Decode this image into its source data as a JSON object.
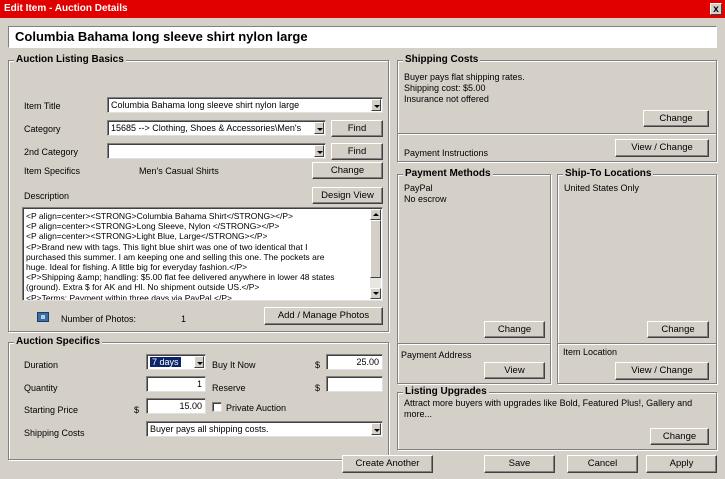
{
  "window": {
    "title": "Edit Item - Auction Details",
    "close": "x"
  },
  "header": {
    "title": "Columbia Bahama long sleeve shirt nylon large"
  },
  "basics": {
    "legend": "Auction Listing Basics",
    "item_title_label": "Item Title",
    "item_title_value": "Columbia Bahama long sleeve shirt nylon large",
    "category_label": "Category",
    "category_value": "15685 --> Clothing, Shoes & Accessories\\Men's",
    "find_label": "Find",
    "category2_label": "2nd Category",
    "category2_value": "",
    "find2_label": "Find",
    "specifics_label": "Item Specifics",
    "specifics_value": "Men's Casual Shirts",
    "change_label": "Change",
    "description_label": "Description",
    "design_view_label": "Design View",
    "description_lines": [
      "<P align=center><STRONG>Columbia Bahama Shirt</STRONG></P>",
      "<P align=center><STRONG>Long Sleeve, Nylon </STRONG></P>",
      "<P align=center><STRONG>Light Blue, Large</STRONG></P>",
      "<P>Brand new with tags. This light blue shirt was one of two identical that I",
      "purchased this summer. I am keeping one and selling this one. The pockets are",
      "huge. Ideal for fishing. A little big for everyday fashion.</P>",
      "<P>Shipping &amp; handling: $5.00 flat fee delivered anywhere in lower 48 states",
      "(ground). Extra $ for AK and HI. No shipment outside US.</P>",
      "<P>Terms: Payment within three days via PayPal.</P>"
    ],
    "photos_label": "Number of Photos:",
    "photos_count": "1",
    "manage_photos_label": "Add / Manage Photos"
  },
  "specifics": {
    "legend": "Auction Specifics",
    "duration_label": "Duration",
    "duration_value": "7 days",
    "buy_now_label": "Buy It Now",
    "dollar": "$",
    "buy_now_value": "25.00",
    "quantity_label": "Quantity",
    "quantity_value": "1",
    "reserve_label": "Reserve",
    "reserve_value": "",
    "starting_price_label": "Starting Price",
    "starting_price_value": "15.00",
    "private_label": "Private Auction",
    "shipping_label": "Shipping Costs",
    "shipping_value": "Buyer pays all shipping costs."
  },
  "shipping": {
    "legend": "Shipping Costs",
    "lines": [
      "Buyer pays flat shipping rates.",
      "Shipping cost: $5.00",
      "Insurance not offered"
    ],
    "change_label": "Change",
    "payment_instructions_label": "Payment Instructions",
    "view_change_label": "View / Change"
  },
  "payment": {
    "legend": "Payment Methods",
    "lines": [
      "PayPal",
      "No escrow"
    ],
    "change_label": "Change",
    "address_label": "Payment Address",
    "view_label": "View"
  },
  "shipto": {
    "legend": "Ship-To Locations",
    "lines": [
      "United States Only"
    ],
    "change_label": "Change",
    "location_label": "Item Location",
    "view_change_label": "View / Change"
  },
  "upgrades": {
    "legend": "Listing Upgrades",
    "text": "Attract more buyers with upgrades like Bold, Featured Plus!, Gallery and more...",
    "change_label": "Change"
  },
  "footer": {
    "create_another": "Create Another",
    "save": "Save",
    "cancel": "Cancel",
    "apply": "Apply"
  },
  "colors": {
    "titlebar": "#e00000",
    "dialog": "#d4d0c8",
    "selection": "#0a246a"
  }
}
